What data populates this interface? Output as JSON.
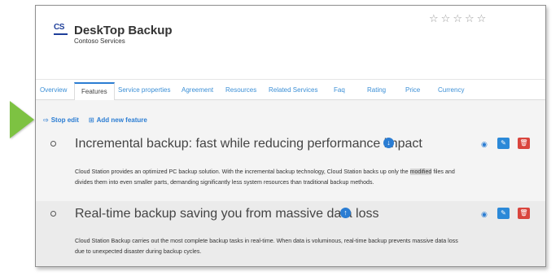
{
  "service": {
    "logo_text": "CS",
    "title": "DeskTop Backup",
    "company": "Contoso Services",
    "rating_stars": 5,
    "rating_value": 0
  },
  "tabs": [
    {
      "label": "Overview"
    },
    {
      "label": "Features",
      "active": true
    },
    {
      "label": "Service properties"
    },
    {
      "label": "Agreement"
    },
    {
      "label": "Resources"
    },
    {
      "label": "Related Services"
    },
    {
      "label": "Faq"
    },
    {
      "label": "Rating"
    },
    {
      "label": "Price"
    },
    {
      "label": "Currency"
    }
  ],
  "actions": {
    "stop_edit": "Stop edit",
    "add_feature": "Add new feature"
  },
  "features": [
    {
      "title": "Incremental backup: fast while reducing performance impact",
      "arrow": "down",
      "desc_before": "Cloud Station provides an optimized PC backup solution. With the incremental backup technology, Cloud Station backs up only the ",
      "desc_highlight": "modified",
      "desc_after": " files and divides them into even smaller parts, demanding significantly less system resources than traditional backup methods."
    },
    {
      "title": "Real-time backup saving you from massive data loss",
      "arrow": "up",
      "desc": "Cloud Station Backup carries out the most complete backup tasks in real-time. When data is voluminous, real-time backup prevents massive data loss due to unexpected disaster during backup cycles."
    }
  ],
  "colors": {
    "accent": "#2b7dd3",
    "delete": "#d9453d",
    "pointer": "#7dc242"
  },
  "icons": {
    "star": "star-outline-icon",
    "eye": "eye-icon",
    "edit": "pencil-icon",
    "delete": "trash-icon"
  }
}
